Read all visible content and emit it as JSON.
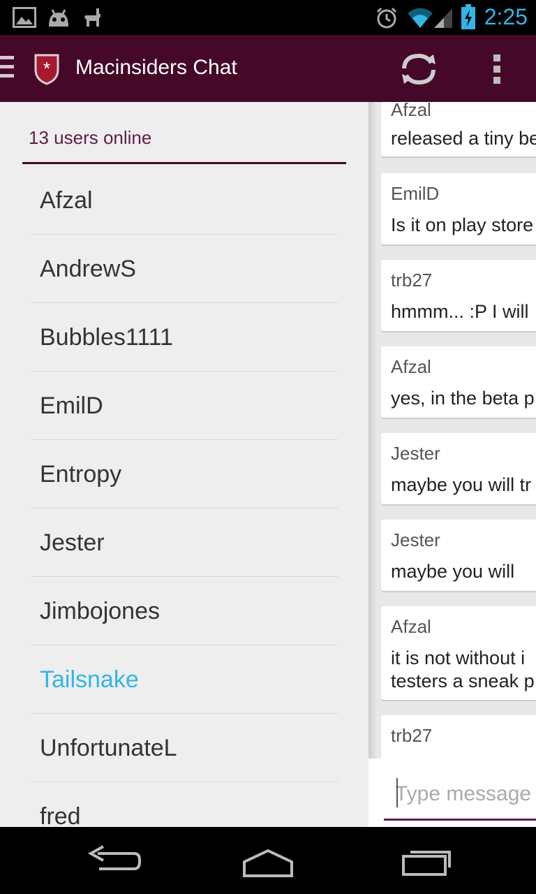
{
  "status_bar": {
    "time": "2:25",
    "icons": [
      "gallery-icon",
      "android-icon",
      "llama-icon",
      "alarm-icon",
      "wifi-icon",
      "cell-signal-icon",
      "battery-charging-icon"
    ],
    "accent": "#33b5e5"
  },
  "action_bar": {
    "title": "Macinsiders Chat",
    "background": "#450828",
    "actions": [
      "refresh-icon",
      "overflow-menu-icon"
    ]
  },
  "drawer": {
    "online_label": "13 users online",
    "users": [
      {
        "name": "Afzal"
      },
      {
        "name": "AndrewS"
      },
      {
        "name": "Bubbles1111"
      },
      {
        "name": "EmilD"
      },
      {
        "name": "Entropy"
      },
      {
        "name": "Jester"
      },
      {
        "name": "Jimbojones"
      },
      {
        "name": "Tailsnake"
      },
      {
        "name": "UnfortunateL"
      },
      {
        "name": "fred"
      }
    ],
    "active_user": "Tailsnake",
    "active_color": "#33b5e5"
  },
  "chat": {
    "messages": [
      {
        "author": "Afzal",
        "text": "released a tiny be"
      },
      {
        "author": "EmilD",
        "text": "Is it on play store"
      },
      {
        "author": "trb27",
        "text": "hmmm... :P I will"
      },
      {
        "author": "Afzal",
        "text": "yes, in the beta p"
      },
      {
        "author": "Jester",
        "text": "maybe you will tr"
      },
      {
        "author": "Jester",
        "text": "maybe you will"
      },
      {
        "author": "Afzal",
        "text": "it is not without i\ntesters a sneak p"
      },
      {
        "author": "trb27",
        "text": ""
      }
    ],
    "input_placeholder": "Type message"
  },
  "nav_bar": {
    "buttons": [
      "back-icon",
      "home-icon",
      "recent-apps-icon"
    ]
  }
}
